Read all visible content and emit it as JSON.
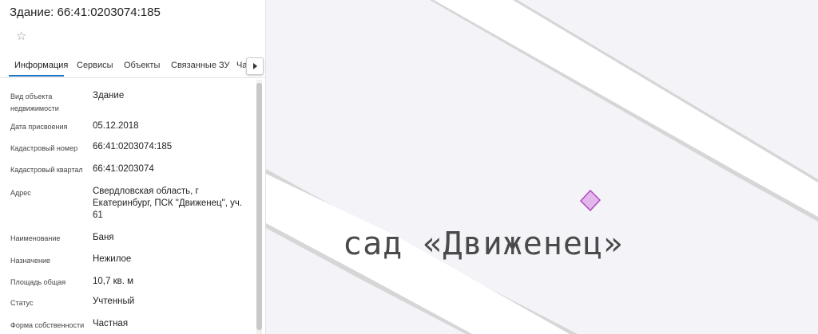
{
  "panel": {
    "title": "Здание: 66:41:0203074:185",
    "tabs": [
      {
        "label": "Информация"
      },
      {
        "label": "Сервисы"
      },
      {
        "label": "Объекты"
      },
      {
        "label": "Связанные ЗУ"
      },
      {
        "label": "Ча"
      }
    ],
    "fields": [
      {
        "label": "Вид объекта недвижимости",
        "value": "Здание"
      },
      {
        "label": "Дата присвоения",
        "value": "05.12.2018"
      },
      {
        "label": "Кадастровый номер",
        "value": "66:41:0203074:185"
      },
      {
        "label": "Кадастровый квартал",
        "value": "66:41:0203074"
      },
      {
        "label": "Адрес",
        "value": "Свердловская область, г Екатеринбург, ПСК \"Движенец\", уч. 61"
      },
      {
        "label": "Наименование",
        "value": "Баня"
      },
      {
        "label": "Назначение",
        "value": "Нежилое"
      },
      {
        "label": "Площадь общая",
        "value": "10,7 кв. м"
      },
      {
        "label": "Статус",
        "value": "Учтенный"
      },
      {
        "label": "Форма собственности",
        "value": "Частная"
      }
    ]
  },
  "map": {
    "label": "сад «Движенец»",
    "colors": {
      "background": "#f4f3f8",
      "road": "#ffffff",
      "road_edge": "#c9c9c9",
      "parcel_fill": "#e3b6ec",
      "parcel_stroke": "#b24cc0"
    }
  },
  "icons": {
    "star": "star-icon",
    "tab_scroll": "chevron-right-icon"
  }
}
